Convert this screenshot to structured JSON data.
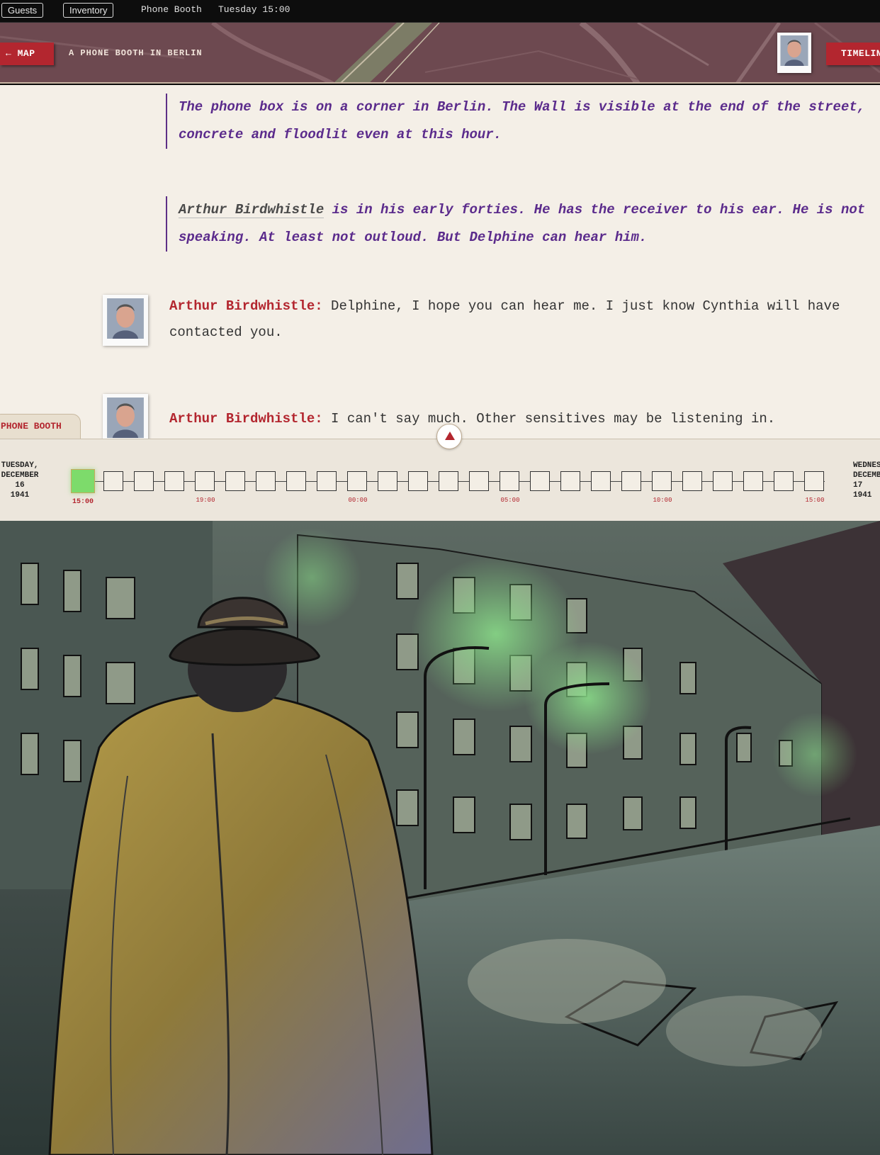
{
  "topbar": {
    "guests_label": "Guests",
    "inventory_label": "Inventory",
    "location": "Phone Booth",
    "time": "Tuesday 15:00"
  },
  "header": {
    "map_button": "← MAP",
    "location_title": "A PHONE BOOTH IN BERLIN",
    "timeline_button": "TIMELINE"
  },
  "transcript": {
    "narration_1": "The phone box is on a corner in Berlin. The Wall is visible at the end of the street, concrete and floodlit even at this hour.",
    "narration_2_name": "Arthur Birdwhistle",
    "narration_2_rest": " is in his early forties. He has the receiver to his ear. He is not speaking. At least not outloud. But Delphine can hear him.",
    "dialog": [
      {
        "speaker": "Arthur Birdwhistle:",
        "text": "Delphine, I hope you can hear me. I just know Cynthia will have contacted you."
      },
      {
        "speaker": "Arthur Birdwhistle:",
        "text": "I can't say much. Other sensitives may be listening in."
      }
    ]
  },
  "location_tab": "PHONE BOOTH",
  "timeline": {
    "start_date": [
      "TUESDAY,",
      "DECEMBER",
      "16",
      "1941"
    ],
    "end_date": [
      "WEDNESDAY,",
      "DECEMBER",
      "17",
      "1941"
    ],
    "current_label": "15:00",
    "ticks": [
      "19:00",
      "00:00",
      "05:00",
      "10:00",
      "15:00"
    ],
    "slot_count": 25,
    "active_slot": 0
  },
  "colors": {
    "accent_red": "#b3262f",
    "narration_purple": "#5b2b8c",
    "paper": "#f4efe7",
    "active_slot": "#7ddb6b"
  }
}
